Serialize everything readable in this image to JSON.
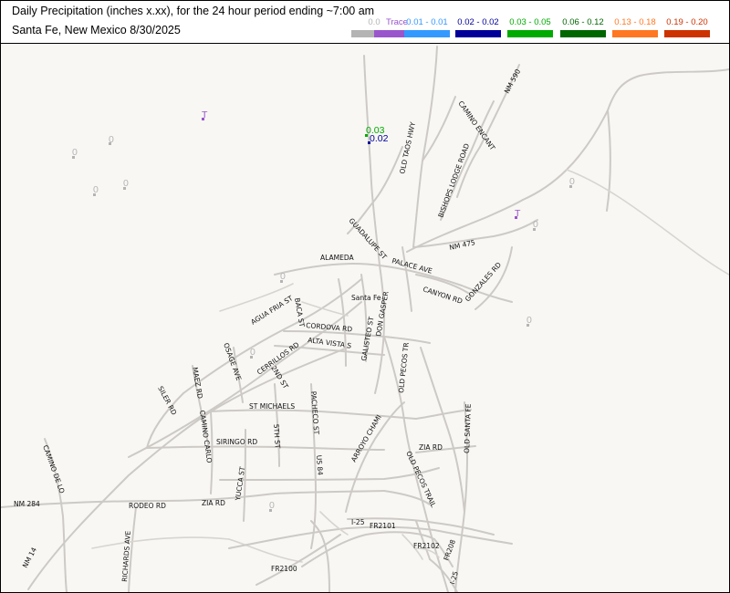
{
  "header": {
    "title_line1": "Daily Precipitation (inches  x.xx),  for the 24 hour period ending ~7:00 am",
    "title_line2": "Santa Fe, New Mexico  8/30/2025"
  },
  "legend": [
    {
      "label": "0.0",
      "color": "#b4b4b4"
    },
    {
      "label": "Trace",
      "color": "#9955cc"
    },
    {
      "label": "0.01 - 0.01",
      "color": "#3399ff"
    },
    {
      "label": "0.02 - 0.02",
      "color": "#000099"
    },
    {
      "label": "0.03 - 0.05",
      "color": "#00aa00"
    },
    {
      "label": "0.06 - 0.12",
      "color": "#006600"
    },
    {
      "label": "0.13 - 0.18",
      "color": "#ff7722"
    },
    {
      "label": "0.19 - 0.20",
      "color": "#cc3300"
    }
  ],
  "map": {
    "city_label": "Santa Fe",
    "road_labels": [
      "NM 590",
      "CAMINO ENCANT",
      "OLD TAOS HWY",
      "BISHOPS LODGE ROAD",
      "GUADALUPE ST",
      "NM 475",
      "ALAMEDA",
      "PALACE AVE",
      "GONZALES RD",
      "CANYON RD",
      "AGUA FRIA ST",
      "BACA ST",
      "CORDOVA RD",
      "GALISTEO ST",
      "DON GASPER",
      "ALTA VISTA S",
      "CERRILLOS RD",
      "OSAGE AVE",
      "MAEZ RD",
      "SILER RD",
      "2ND ST",
      "OLD PECOS TR",
      "ST MICHAELS",
      "PACHECO ST",
      "CAMINO CARLO",
      "SIRINGO RD",
      "5TH ST",
      "ARROYO CHAMI",
      "ZIA RD",
      "OLD SANTA FE",
      "US 84",
      "CAMINO DE LO",
      "YUCCA ST",
      "OLD PECOS TRAIL",
      "NM 284",
      "RODEO RD",
      "ZIA RD",
      "I-25",
      "FR2101",
      "NM 14",
      "RICHARDS AVE",
      "FR2102",
      "FR208",
      "I-25",
      "FR2100"
    ]
  },
  "stations": [
    {
      "value": "T",
      "color": "#9955cc"
    },
    {
      "value": "0",
      "color": "#b4b4b4"
    },
    {
      "value": "0",
      "color": "#b4b4b4"
    },
    {
      "value": "0",
      "color": "#b4b4b4"
    },
    {
      "value": "0",
      "color": "#b4b4b4"
    },
    {
      "value": "0.03",
      "color": "#00aa00"
    },
    {
      "value": "0.02",
      "color": "#000099"
    },
    {
      "value": "0",
      "color": "#b4b4b4"
    },
    {
      "value": "T",
      "color": "#9955cc"
    },
    {
      "value": "0",
      "color": "#b4b4b4"
    },
    {
      "value": "0",
      "color": "#b4b4b4"
    },
    {
      "value": "0",
      "color": "#b4b4b4"
    },
    {
      "value": "0",
      "color": "#b4b4b4"
    }
  ]
}
